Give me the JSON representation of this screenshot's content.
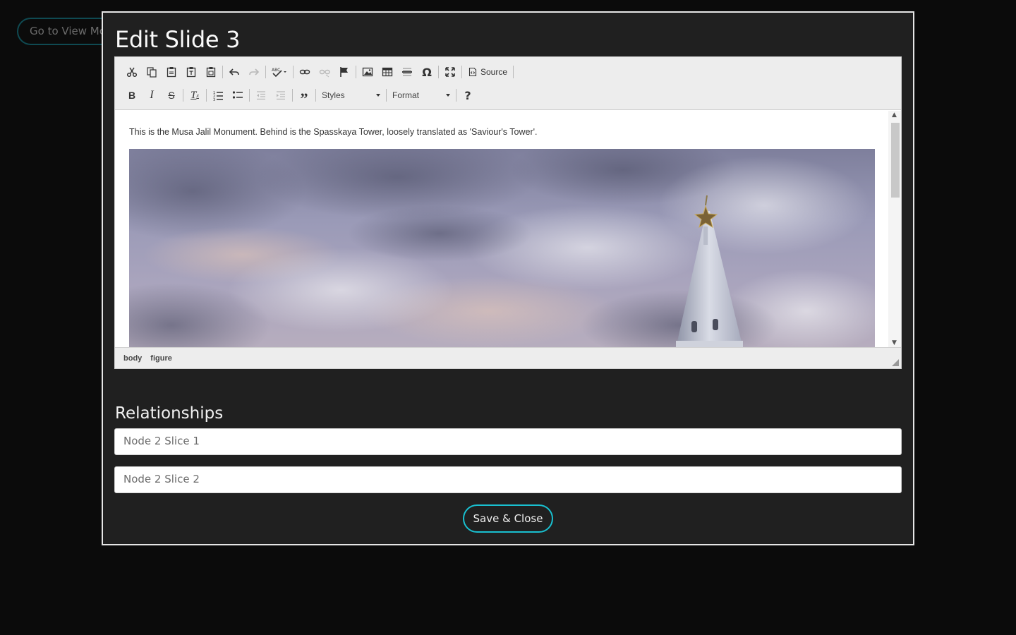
{
  "background": {
    "view_mode_button_label": "Go to View Mc"
  },
  "modal": {
    "title": "Edit Slide 3",
    "relationships_title": "Relationships",
    "save_label": "Save & Close"
  },
  "editor": {
    "toolbar_row1": [
      {
        "name": "cut-icon",
        "glyph": "cut"
      },
      {
        "name": "copy-icon",
        "glyph": "copy"
      },
      {
        "name": "paste-icon",
        "glyph": "paste"
      },
      {
        "name": "paste-text-icon",
        "glyph": "paste-text"
      },
      {
        "name": "paste-word-icon",
        "glyph": "paste-word"
      },
      {
        "name": "undo-icon",
        "glyph": "undo"
      },
      {
        "name": "redo-icon",
        "glyph": "redo"
      },
      {
        "name": "spellcheck-icon",
        "glyph": "spellcheck"
      },
      {
        "name": "link-icon",
        "glyph": "link"
      },
      {
        "name": "unlink-icon",
        "glyph": "unlink"
      },
      {
        "name": "anchor-icon",
        "glyph": "anchor"
      },
      {
        "name": "image-icon",
        "glyph": "image"
      },
      {
        "name": "table-icon",
        "glyph": "table"
      },
      {
        "name": "horizontal-line-icon",
        "glyph": "hr"
      },
      {
        "name": "special-char-icon",
        "glyph": "omega"
      },
      {
        "name": "maximize-icon",
        "glyph": "maximize"
      }
    ],
    "source_label": "Source",
    "styles_label": "Styles",
    "format_label": "Format",
    "help_label": "?",
    "content_text": "This is the Musa Jalil Monument. Behind is the Spasskaya Tower, loosely translated as 'Saviour's Tower'.",
    "image_alt": "Spasskaya Tower against a cloudy sky",
    "path": [
      "body",
      "figure"
    ]
  },
  "relationships": {
    "field1_placeholder": "Node 2 Slice 1",
    "field2_placeholder": "Node 2 Slice 2"
  },
  "colors": {
    "accent": "#19c0d0",
    "modal_bg": "#202020",
    "page_bg": "#0b0b0b"
  }
}
